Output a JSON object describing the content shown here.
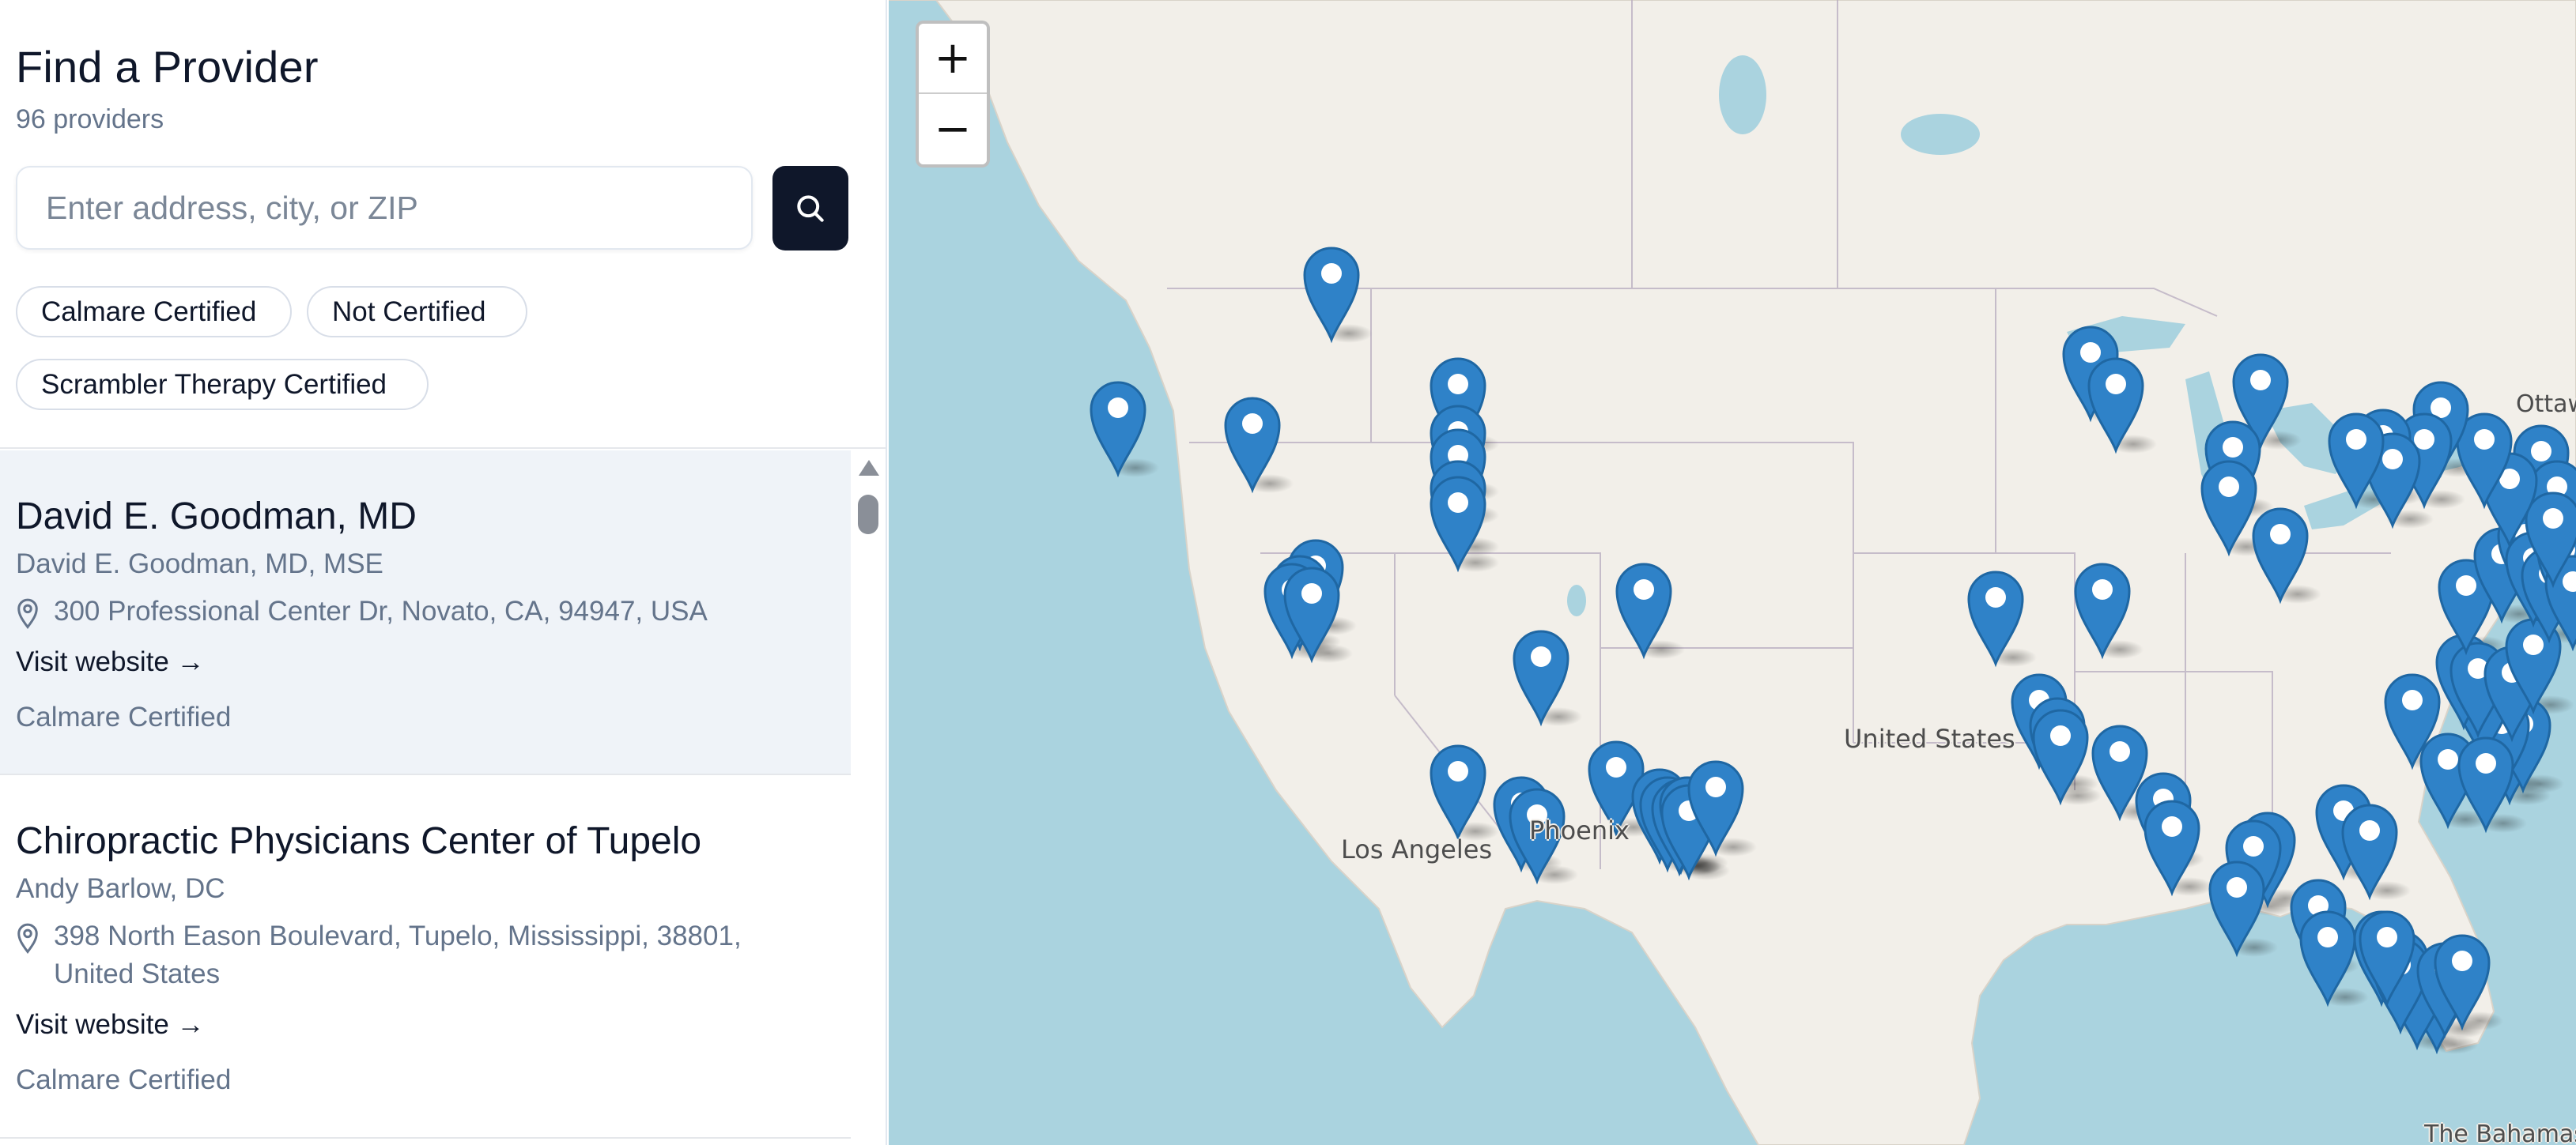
{
  "sidebar": {
    "title": "Find a Provider",
    "count": "96 providers",
    "search": {
      "placeholder": "Enter address, city, or ZIP",
      "value": ""
    },
    "search_button_icon": "search-icon",
    "filters": [
      "Calmare Certified",
      "Not Certified",
      "Scrambler Therapy Certified"
    ]
  },
  "providers": [
    {
      "name": "David E. Goodman, MD",
      "person": "David E. Goodman, MD, MSE",
      "address": "300 Professional Center Dr, Novato, CA, 94947, USA",
      "link": "Visit website →",
      "badge": "Calmare Certified"
    },
    {
      "name": "Chiropractic Physicians Center of Tupelo",
      "person": "Andy Barlow, DC",
      "address": "398 North Eason Boulevard, Tupelo, Mississippi, 38801, United States",
      "link": "Visit website →",
      "badge": "Calmare Certified"
    }
  ],
  "map": {
    "labels": {
      "los_angeles": "Los Angeles",
      "phoenix": "Phoenix",
      "united_states": "United States",
      "ottawa": "Ottawa",
      "bahamas": "The Bahamas"
    },
    "zoom_in": "+",
    "zoom_out": "−",
    "marker_color": "#2f82c8",
    "marker_count_visible": 82
  },
  "colors": {
    "primary_dark": "#0f172a",
    "muted": "#64748b",
    "selected_row": "#eff3f8",
    "water": "#aad3df",
    "land": "#f2efe9"
  }
}
